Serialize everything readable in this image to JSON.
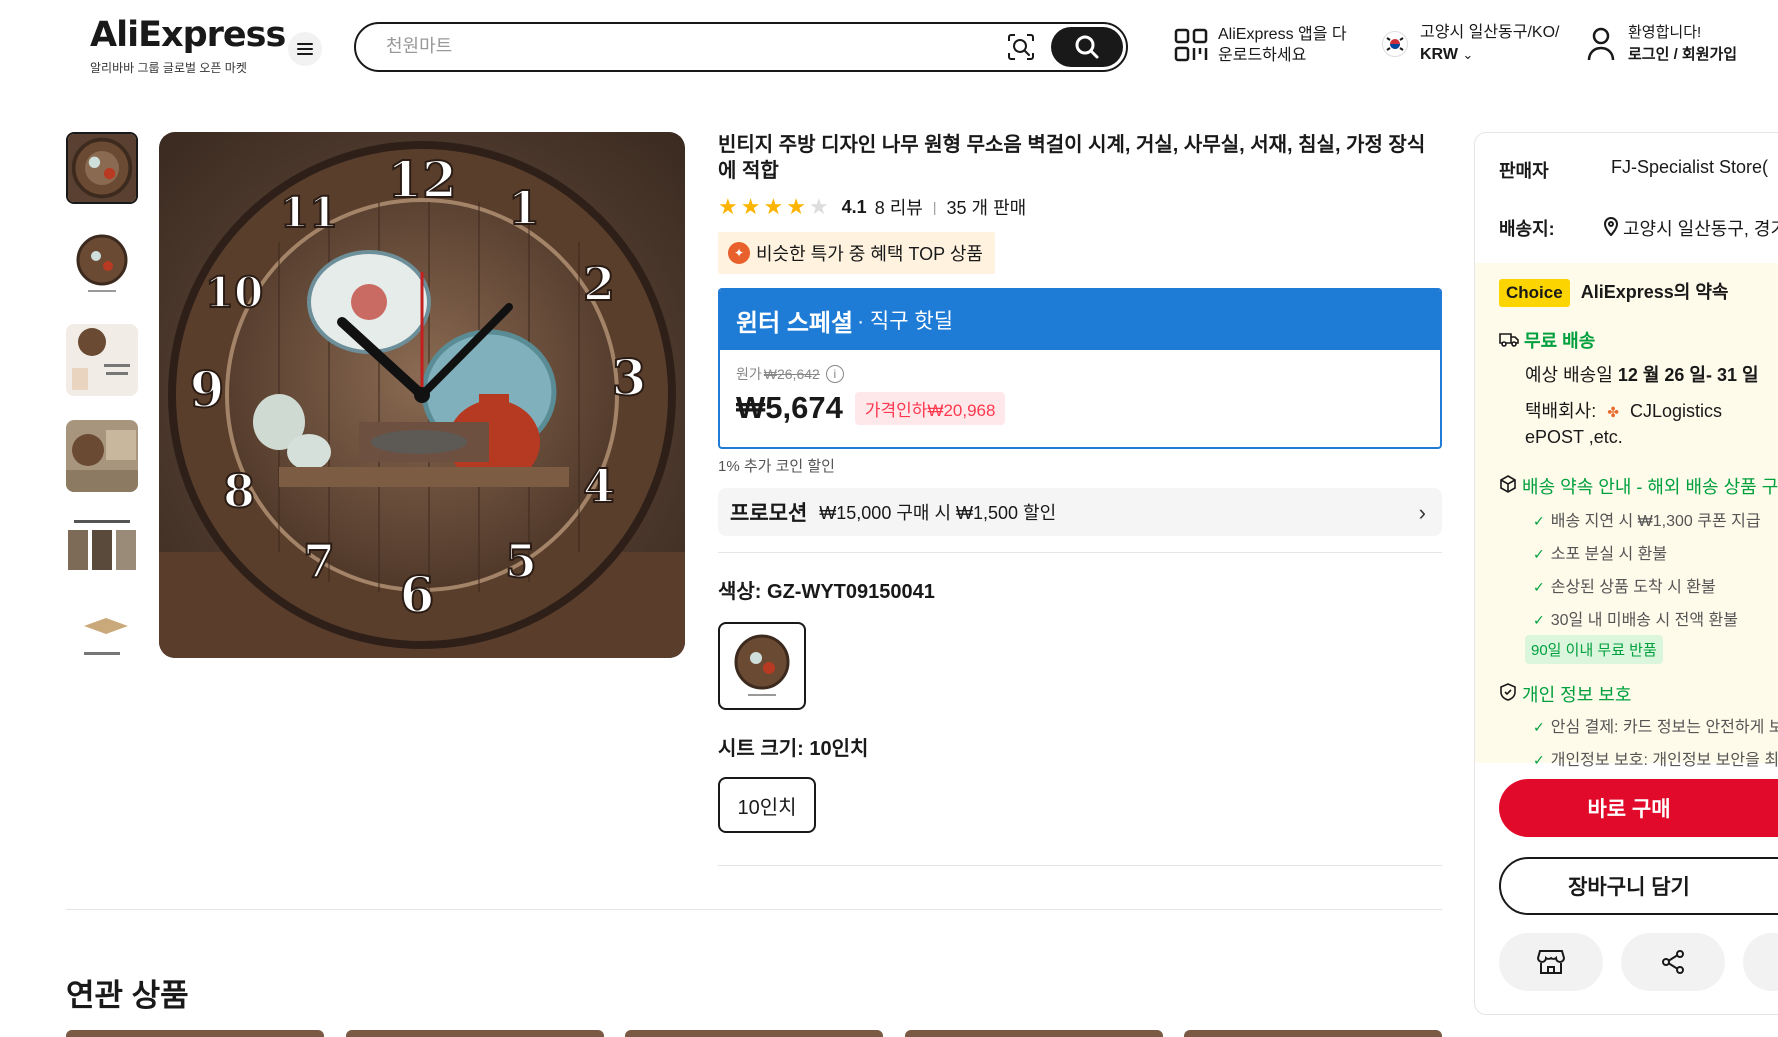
{
  "header": {
    "logo_text": "AliExpress",
    "logo_subtitle": "알리바바 그룹 글로벌 오픈 마켓",
    "search_placeholder": "천원마트",
    "app_download_line1": "AliExpress 앱을 다",
    "app_download_line2": "운로드하세요",
    "locale_line1": "고양시 일산동구/KO/",
    "locale_currency": "KRW",
    "account_line1": "환영합니다!",
    "account_line2": "로그인 / 회원가입"
  },
  "product": {
    "title": "빈티지 주방 디자인 나무 원형 무소음 벽걸이 시계, 거실, 사무실, 서재, 침실, 가정 장식에 적합",
    "rating": "4.1",
    "rating_value": 4.1,
    "reviews": "8 리뷰",
    "sold": "35 개 판매",
    "top_badge": "비슷한 특가 중 혜택 TOP 상품",
    "deal_title": "윈터 스페셜",
    "deal_subtitle": "· 직구 핫딜",
    "original_label": "원가",
    "original_price": "₩26,642",
    "info_icon": "i",
    "price": "₩5,674",
    "discount": "가격인하₩20,968",
    "coin_discount": "1% 추가 코인 할인",
    "promo_label": "프로모션",
    "promo_desc": "₩15,000 구매 시 ₩1,500 할인",
    "color_label": "색상: GZ-WYT09150041",
    "size_label": "시트 크기: 10인치",
    "size_option": "10인치"
  },
  "panel": {
    "seller_label": "판매자",
    "seller_name": "FJ-Specialist Store(",
    "ship_to_label": "배송지:",
    "ship_to": "고양시 일산동구, 경기",
    "choice_tag": "Choice",
    "choice_title": "AliExpress의 약속",
    "free_shipping": "무료 배송",
    "delivery_prefix": "예상 배송일",
    "delivery_dates": "12 월 26 일- 31 일",
    "courier_label": "택배회사:",
    "courier_name": "CJLogistics",
    "courier_more": "ePOST ,etc.",
    "promise_title": "배송 약속 안내 - 해외 배송 상품 구",
    "promise_items": [
      "배송 지연 시 ₩1,300 쿠폰 지급",
      "소포 분실 시 환불",
      "손상된 상품 도착 시 환불",
      "30일 내 미배송 시 전액 환불"
    ],
    "return_badge": "90일 이내 무료 반품",
    "privacy_title": "개인 정보 보호",
    "privacy_items": [
      "안심 결제: 카드 정보는 안전하게 보",
      "개인정보 보호: 개인정보 보안을 최"
    ],
    "buy_now": "바로 구매",
    "add_cart": "장바구니 담기"
  },
  "related": {
    "title": "연관 상품"
  },
  "colors": {
    "accent_red": "#fd384f",
    "buy_red": "#e20a2a",
    "deal_blue": "#1e7cd7",
    "choice_yellow": "#fcd400",
    "green": "#00a03e"
  }
}
